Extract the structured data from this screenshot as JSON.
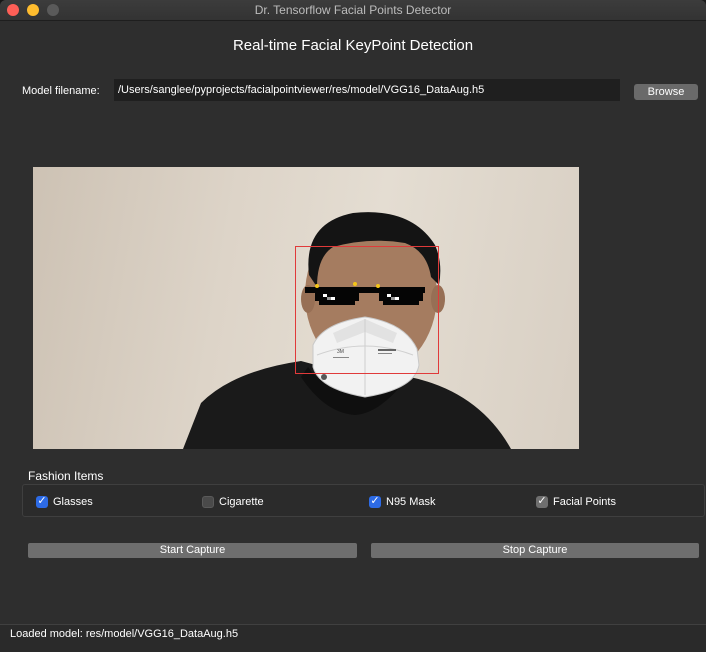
{
  "window": {
    "title": "Dr. Tensorflow Facial Points Detector"
  },
  "app": {
    "heading": "Real-time Facial KeyPoint Detection"
  },
  "model": {
    "label": "Model filename:",
    "value": "/Users/sanglee/pyprojects/facialpointviewer/res/model/VGG16_DataAug.h5",
    "browse_label": "Browse"
  },
  "fashion": {
    "title": "Fashion Items",
    "items": [
      {
        "label": "Glasses",
        "checked": true
      },
      {
        "label": "Cigarette",
        "checked": false
      },
      {
        "label": "N95 Mask",
        "checked": true
      },
      {
        "label": "Facial Points",
        "checked": true
      }
    ]
  },
  "capture": {
    "start_label": "Start Capture",
    "stop_label": "Stop Capture"
  },
  "status": {
    "text": "Loaded model: res/model/VGG16_DataAug.h5"
  },
  "mask": {
    "brand_text": "3M"
  },
  "colors": {
    "accent_checkbox": "#2d6be6",
    "face_box": "#e03a3a",
    "keypoint": "#f5c518",
    "window_bg": "#2e2e2e"
  },
  "icons": {
    "checkmark": "checkmark-icon",
    "close": "close-window-icon",
    "minimize": "minimize-window-icon",
    "maximize": "maximize-window-icon"
  }
}
